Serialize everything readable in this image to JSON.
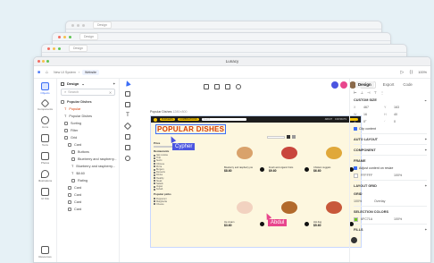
{
  "app_title": "Lunacy",
  "ghost_windows": [
    {
      "tab": "Design"
    },
    {
      "tab": "Design"
    },
    {
      "tab": "Design"
    }
  ],
  "toolbar": {
    "crumb_project": "New UI System",
    "crumb_file": "Website",
    "share_label": "Share"
  },
  "left_rail": [
    {
      "label": "Objects",
      "active": true
    },
    {
      "label": "Components"
    },
    {
      "label": "Icons"
    },
    {
      "label": "Texts"
    },
    {
      "label": "Photos"
    },
    {
      "label": "Illustrations"
    },
    {
      "label": "UI Kits"
    },
    {
      "label": "Resources"
    }
  ],
  "layers": {
    "page_name": "Design",
    "search_placeholder": "Search",
    "rows": [
      "Popular Dishes",
      "Popular",
      "Popular Dishes",
      "Sorting",
      "Filter",
      "Grid",
      "Card",
      "Buttons",
      "Blueberry and raspberry...",
      "Blueberry and raspberry...",
      "$8.60",
      "Rating",
      "Card",
      "Card",
      "Card",
      "Card"
    ]
  },
  "frame": {
    "name": "Popular Dishes",
    "size": "1280×800",
    "title": "POPULAR DISHES",
    "nav_pills": [
      "BURGERS",
      "COMBINATIONS"
    ],
    "search_placeholder": "Search...",
    "nav_links": [
      "ABOUT",
      "CONTACTS"
    ],
    "price_label": "Price",
    "filter_sections": [
      {
        "title": "Restaurants",
        "items": [
          "Italy cuisine",
          "Thai",
          "Sushi",
          "Chinese",
          "Pizza",
          "Burgers",
          "Desserts",
          "Drinks",
          "Healthy",
          "Steak",
          "Salads",
          "Vegan",
          "Kebab"
        ]
      },
      {
        "title": "Popular picks",
        "items": [
          "Pepperoni",
          "Margherita",
          "Cheese"
        ]
      }
    ],
    "cards": [
      {
        "name": "Blueberry and raspberry pie",
        "price": "$8.60",
        "food": "#d9a26b"
      },
      {
        "name": "Fresh and organic fruits",
        "price": "$9.60",
        "food": "#c9463d"
      },
      {
        "name": "Chicken nuggets",
        "price": "$6.60",
        "food": "#e0a83a"
      },
      {
        "name": "Ice cream",
        "price": "$3.60",
        "food": "#f2d2c0"
      },
      {
        "name": "Classic burger",
        "price": "$9.60",
        "food": "#b26a2c"
      },
      {
        "name": "Hot dog",
        "price": "$5.60",
        "food": "#c8583a"
      }
    ]
  },
  "collaborators": [
    {
      "name": "Cypher",
      "color": "#4b55e0"
    },
    {
      "name": "Abdul",
      "color": "#e8468d"
    }
  ],
  "right_panel": {
    "zoom": "100%",
    "tabs": [
      "Design",
      "Export",
      "Code"
    ],
    "sections": {
      "custom_size": "CUSTOM SIZE",
      "x": "467",
      "y": "163",
      "w": "16",
      "h": "40",
      "rot": "0°",
      "radius": "0",
      "clip": "Clip content",
      "auto_layout": "AUTO LAYOUT",
      "component": "COMPONENT",
      "frame": "FRAME",
      "adjust": "Adjust content on resize",
      "fill_hex": "FFFFFF",
      "fill_opacity": "100%",
      "layout_grid": "LAYOUT GRID",
      "grid": "GRID",
      "grid_opacity": "100%",
      "grid_color": "Overlay",
      "selection_colors": "SELECTION COLORS",
      "sel_hex": "6FC71A",
      "sel_opacity": "100%",
      "fills": "FILLS"
    }
  }
}
